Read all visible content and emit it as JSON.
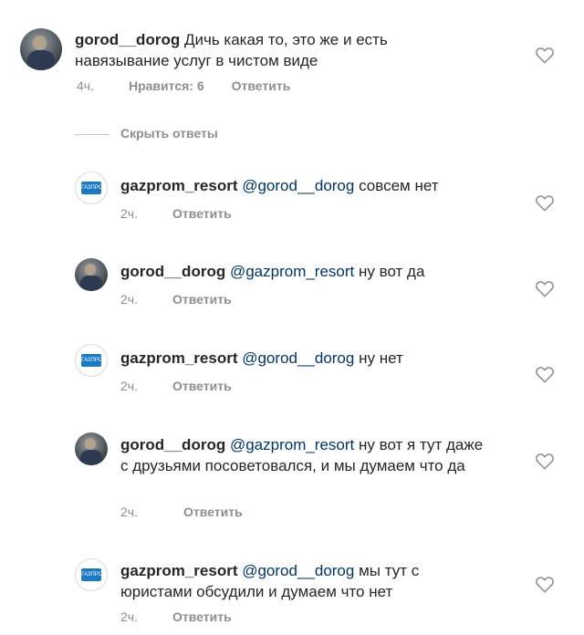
{
  "comments": [
    {
      "username": "gorod__dorog",
      "mention": "",
      "text": "Дичь какая то, это же и есть навязывание услуг в чистом виде",
      "time": "4ч.",
      "likes": "Нравится: 6",
      "reply": "Ответить",
      "avatar": "user-photo"
    },
    {
      "username": "gazprom_resort",
      "mention": "@gorod__dorog",
      "text": "совсем нет",
      "time": "2ч.",
      "reply": "Ответить",
      "avatar": "gazprom-logo"
    },
    {
      "username": "gorod__dorog",
      "mention": "@gazprom_resort",
      "text": "ну вот да",
      "time": "2ч.",
      "reply": "Ответить",
      "avatar": "user-photo"
    },
    {
      "username": "gazprom_resort",
      "mention": "@gorod__dorog",
      "text": "ну нет",
      "time": "2ч.",
      "reply": "Ответить",
      "avatar": "gazprom-logo"
    },
    {
      "username": "gorod__dorog",
      "mention": "@gazprom_resort",
      "text": "ну вот я тут даже с друзьями посоветовался, и мы думаем что да",
      "time": "2ч.",
      "reply": "Ответить",
      "avatar": "user-photo"
    },
    {
      "username": "gazprom_resort",
      "mention": "@gorod__dorog",
      "text": "мы тут с юристами обсудили и думаем что нет",
      "time": "2ч.",
      "reply": "Ответить",
      "avatar": "gazprom-logo"
    }
  ],
  "hide_replies_label": "Скрыть ответы",
  "brand_logo_text": "ГАЗПРОМ",
  "icons": {
    "like": "heart-outline-icon"
  },
  "colors": {
    "text": "#262626",
    "meta": "#8e8e8e",
    "mention": "#003569",
    "brand": "#1a7ac4"
  }
}
